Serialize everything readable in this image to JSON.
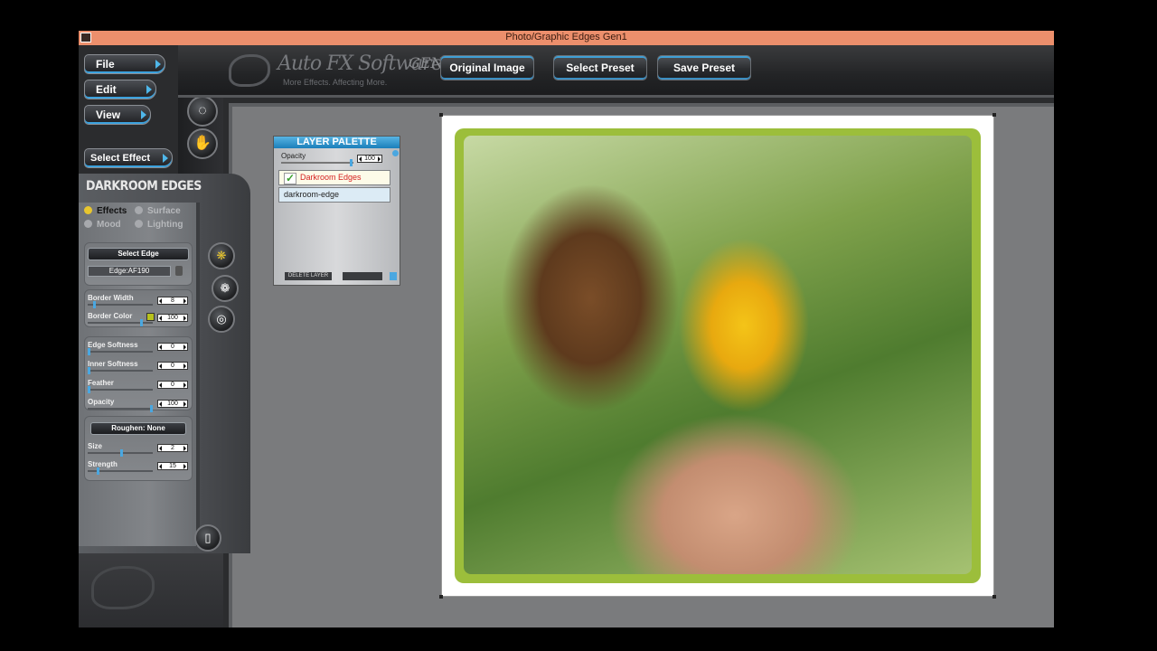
{
  "window": {
    "title": "Photo/Graphic Edges Gen1"
  },
  "menu": {
    "file": "File",
    "edit": "Edit",
    "view": "View",
    "select_effect": "Select Effect"
  },
  "logo": {
    "brand": "Auto FX Software",
    "gen": "GEN 1",
    "tagline": "More Effects. Affecting More."
  },
  "top_buttons": {
    "original": "Original Image",
    "select_preset": "Select Preset",
    "save_preset": "Save Preset"
  },
  "tools": {
    "zoom": "zoom-icon",
    "select": "selection-icon",
    "hand": "hand-icon"
  },
  "effect_panel": {
    "header": "DARKROOM EDGES",
    "tabs": {
      "effects": "Effects",
      "surface": "Surface",
      "mood": "Mood",
      "lighting": "Lighting"
    },
    "select_edge": "Select Edge",
    "edge_name": "Edge:AF190",
    "border_width": {
      "label": "Border Width",
      "value": "8"
    },
    "border_color": {
      "label": "Border Color",
      "value": "100",
      "swatch": "#b8c21c"
    },
    "edge_softness": {
      "label": "Edge Softness",
      "value": "0"
    },
    "inner_softness": {
      "label": "Inner Softness",
      "value": "0"
    },
    "feather": {
      "label": "Feather",
      "value": "0"
    },
    "opacity": {
      "label": "Opacity",
      "value": "100"
    },
    "roughen": "Roughen: None",
    "size": {
      "label": "Size",
      "value": "2"
    },
    "strength": {
      "label": "Strength",
      "value": "15"
    }
  },
  "layer_palette": {
    "title": "LAYER PALETTE",
    "opacity_label": "Opacity",
    "opacity_value": "100",
    "layers": [
      "Darkroom Edges",
      "darkroom-edge"
    ],
    "delete_label": "DELETE LAYER"
  },
  "colors": {
    "accent": "#3ba2de",
    "titlebar": "#ec8f6c",
    "selected_layer_text": "#d52020"
  }
}
